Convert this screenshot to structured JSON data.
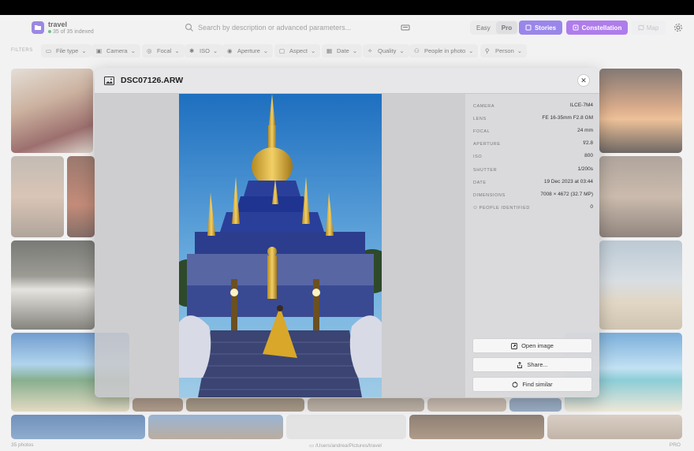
{
  "library": {
    "name": "travel",
    "indexed_text": "35 of 35 indexed"
  },
  "search": {
    "placeholder": "Search by description or advanced parameters..."
  },
  "mode": {
    "easy": "Easy",
    "pro": "Pro",
    "selected": "Pro"
  },
  "buttons": {
    "stories": "Stories",
    "constellation": "Constellation",
    "map": "Map"
  },
  "filters": {
    "label": "FILTERS",
    "chips": [
      "File type",
      "Camera",
      "Focal",
      "ISO",
      "Aperture",
      "Aspect",
      "Date",
      "Quality",
      "People in photo",
      "Person"
    ]
  },
  "status": {
    "count": "35 photos",
    "path": "/Users/andrea/Pictures/travel",
    "mode": "PRO"
  },
  "modal": {
    "filename": "DSC07126.ARW",
    "metadata": [
      {
        "key": "CAMERA",
        "value": "ILCE-7M4"
      },
      {
        "key": "LENS",
        "value": "FE 16-35mm F2.8 GM"
      },
      {
        "key": "FOCAL",
        "value": "24 mm"
      },
      {
        "key": "APERTURE",
        "value": "f/2.8"
      },
      {
        "key": "ISO",
        "value": "800"
      },
      {
        "key": "SHUTTER",
        "value": "1/200s"
      },
      {
        "key": "DATE",
        "value": "19 Dec 2023 at 03:44"
      },
      {
        "key": "DIMENSIONS",
        "value": "7008 × 4672 (32.7 MP)"
      },
      {
        "key": "PEOPLE IDENTIFIED",
        "value": "0"
      }
    ],
    "actions": {
      "open": "Open image",
      "share": "Share...",
      "similar": "Find similar"
    }
  },
  "colors": {
    "accent_stories": "#6a4de0",
    "accent_constellation": "#8a3ee3",
    "indexed_dot": "#2ba84a"
  }
}
